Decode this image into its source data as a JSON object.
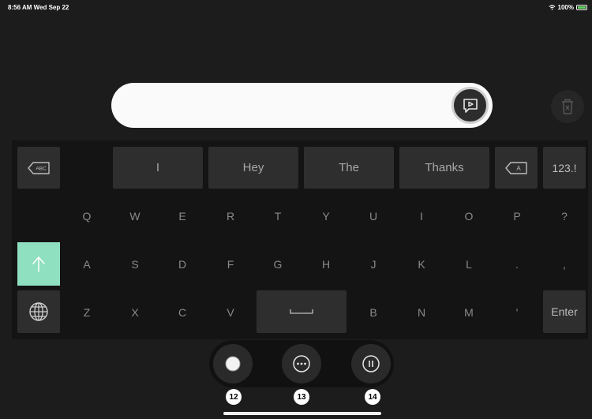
{
  "status": {
    "time": "8:56 AM  Wed Sep 22",
    "battery": "100%"
  },
  "suggestions": [
    "I",
    "Hey",
    "The",
    "Thanks"
  ],
  "keys": {
    "numbers": "123.!",
    "row1": [
      "Q",
      "W",
      "E",
      "R",
      "T",
      "Y",
      "U",
      "I",
      "O",
      "P",
      "?"
    ],
    "row2": [
      "A",
      "S",
      "D",
      "F",
      "G",
      "H",
      "J",
      "K",
      "L",
      ".",
      ","
    ],
    "row3_left": [
      "Z",
      "X",
      "C",
      "V"
    ],
    "row3_right": [
      "B",
      "N",
      "M",
      "'"
    ],
    "enter": "Enter",
    "abc_label": "ABC",
    "a_label": "A"
  },
  "badges": [
    "12",
    "13",
    "14"
  ],
  "colors": {
    "shift_key": "#8ee0c0",
    "text_bar": "#fafafa",
    "background": "#1c1c1c"
  },
  "icons": [
    "speak-icon",
    "trash-icon",
    "backspace-word-icon",
    "backspace-char-icon",
    "shift-arrow-icon",
    "globe-icon",
    "space-icon",
    "record-icon",
    "more-icon",
    "pause-icon"
  ]
}
